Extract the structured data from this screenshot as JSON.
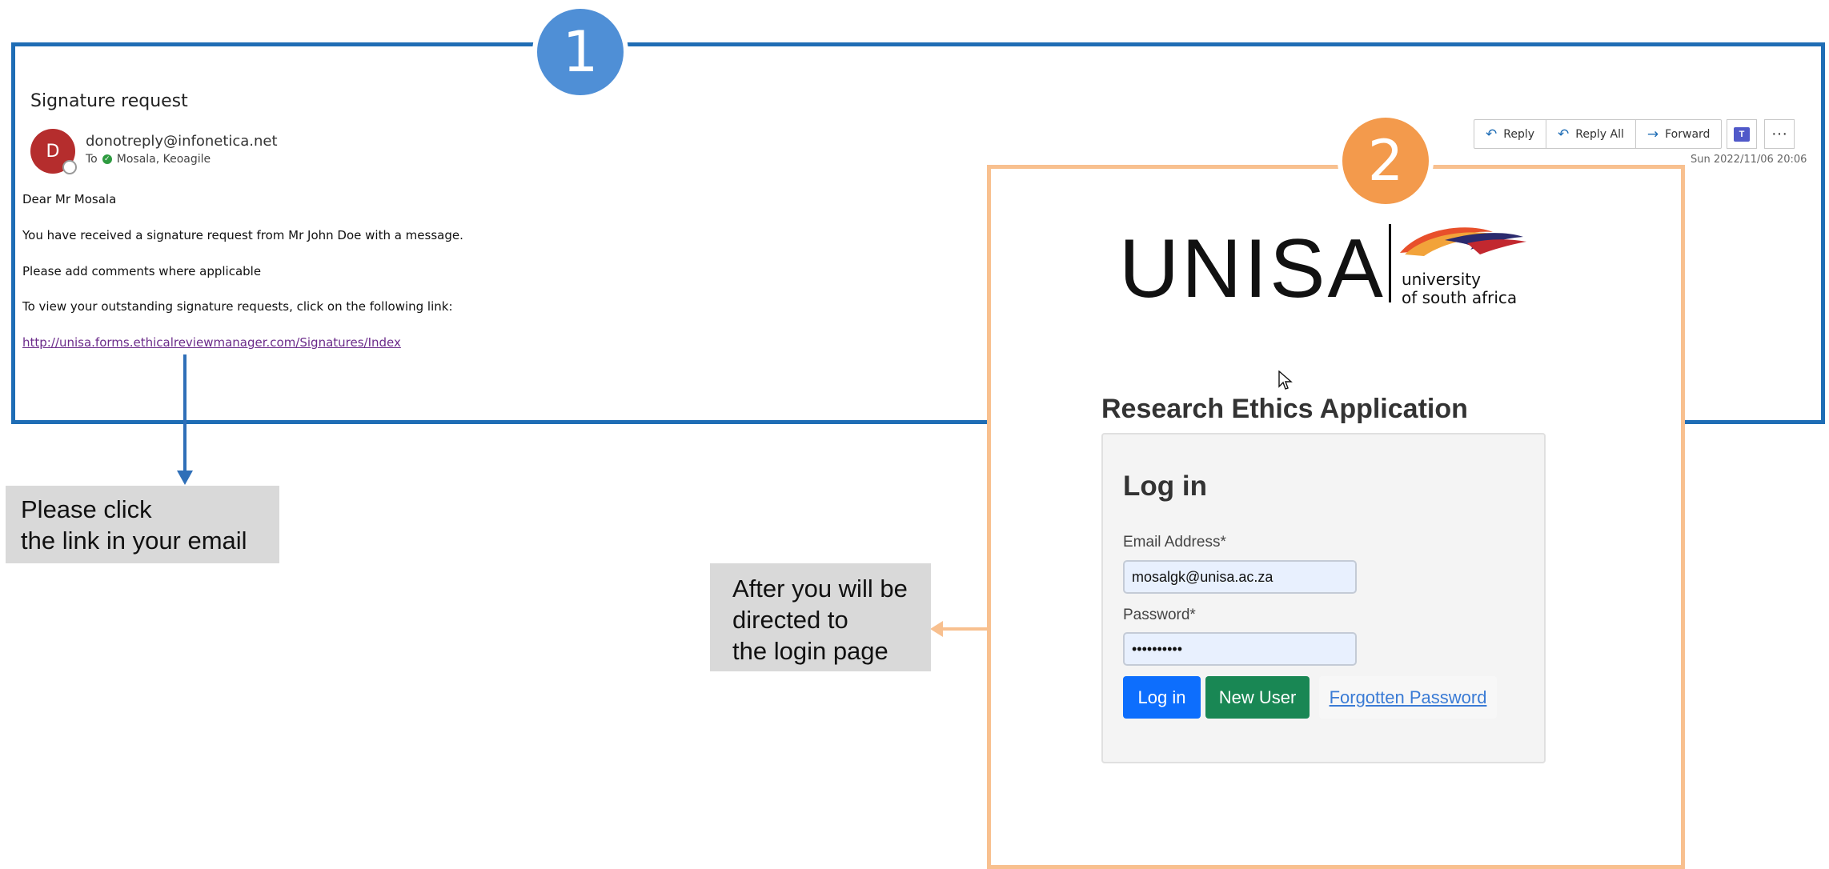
{
  "steps": {
    "step1": "1",
    "step2": "2"
  },
  "email": {
    "subject": "Signature request",
    "avatar_initial": "D",
    "sender": "donotreply@infonetica.net",
    "to_label": "To",
    "recipient": "Mosala, Keoagile",
    "timestamp": "Sun 2022/11/06 20:06",
    "actions": {
      "reply": "Reply",
      "reply_all": "Reply All",
      "forward": "Forward"
    },
    "more_label": "···",
    "body": {
      "greeting": "Dear  Mr Mosala",
      "line1": "You have received a signature request from  Mr John Doe with a message.",
      "line2": "Please add comments where applicable",
      "line3": "To view your outstanding signature requests, click on the following link:",
      "link": "http://unisa.forms.ethicalreviewmanager.com/Signatures/Index"
    }
  },
  "callouts": {
    "click_link": {
      "line1": "Please click",
      "line2": "the link in your email"
    },
    "login_page": {
      "line1": "After you will be",
      "line2": "directed to",
      "line3": "the login page"
    }
  },
  "login": {
    "logo_text": "UNISA",
    "logo_sub1": "university",
    "logo_sub2": "of south africa",
    "app_title": "Research Ethics Application",
    "heading": "Log in",
    "email_label": "Email Address*",
    "email_value": "mosalgk@unisa.ac.za",
    "password_label": "Password*",
    "password_value": "••••••••••",
    "login_button": "Log in",
    "new_user_button": "New User",
    "forgot_link": "Forgotten Password"
  },
  "colors": {
    "panel1_border": "#1f6db5",
    "panel2_border": "#f8c08f",
    "badge1": "#4f8fd6",
    "badge2": "#f39a4c",
    "login_btn": "#0d6efd",
    "new_user_btn": "#198754"
  },
  "icons": [
    "reply-icon",
    "reply-all-icon",
    "forward-icon",
    "teams-icon",
    "more-icon",
    "cursor-icon",
    "unisa-logo-icon"
  ]
}
